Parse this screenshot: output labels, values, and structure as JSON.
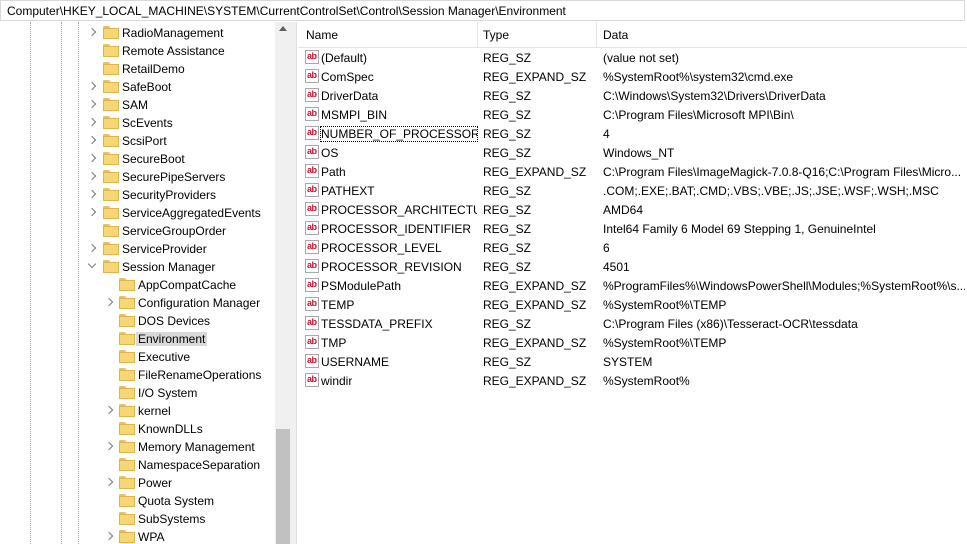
{
  "address_bar": {
    "path": "Computer\\HKEY_LOCAL_MACHINE\\SYSTEM\\CurrentControlSet\\Control\\Session Manager\\Environment"
  },
  "tree": {
    "items": [
      {
        "label": "RadioManagement",
        "level": 1,
        "expandable": true,
        "expanded": false,
        "selected": false
      },
      {
        "label": "Remote Assistance",
        "level": 1,
        "expandable": false,
        "expanded": false,
        "selected": false
      },
      {
        "label": "RetailDemo",
        "level": 1,
        "expandable": false,
        "expanded": false,
        "selected": false
      },
      {
        "label": "SafeBoot",
        "level": 1,
        "expandable": true,
        "expanded": false,
        "selected": false
      },
      {
        "label": "SAM",
        "level": 1,
        "expandable": true,
        "expanded": false,
        "selected": false
      },
      {
        "label": "ScEvents",
        "level": 1,
        "expandable": true,
        "expanded": false,
        "selected": false
      },
      {
        "label": "ScsiPort",
        "level": 1,
        "expandable": true,
        "expanded": false,
        "selected": false
      },
      {
        "label": "SecureBoot",
        "level": 1,
        "expandable": true,
        "expanded": false,
        "selected": false
      },
      {
        "label": "SecurePipeServers",
        "level": 1,
        "expandable": true,
        "expanded": false,
        "selected": false
      },
      {
        "label": "SecurityProviders",
        "level": 1,
        "expandable": true,
        "expanded": false,
        "selected": false
      },
      {
        "label": "ServiceAggregatedEvents",
        "level": 1,
        "expandable": true,
        "expanded": false,
        "selected": false
      },
      {
        "label": "ServiceGroupOrder",
        "level": 1,
        "expandable": false,
        "expanded": false,
        "selected": false
      },
      {
        "label": "ServiceProvider",
        "level": 1,
        "expandable": true,
        "expanded": false,
        "selected": false
      },
      {
        "label": "Session Manager",
        "level": 1,
        "expandable": true,
        "expanded": true,
        "selected": false
      },
      {
        "label": "AppCompatCache",
        "level": 2,
        "expandable": false,
        "expanded": false,
        "selected": false
      },
      {
        "label": "Configuration Manager",
        "level": 2,
        "expandable": true,
        "expanded": false,
        "selected": false
      },
      {
        "label": "DOS Devices",
        "level": 2,
        "expandable": false,
        "expanded": false,
        "selected": false
      },
      {
        "label": "Environment",
        "level": 2,
        "expandable": false,
        "expanded": false,
        "selected": true
      },
      {
        "label": "Executive",
        "level": 2,
        "expandable": false,
        "expanded": false,
        "selected": false
      },
      {
        "label": "FileRenameOperations",
        "level": 2,
        "expandable": false,
        "expanded": false,
        "selected": false
      },
      {
        "label": "I/O System",
        "level": 2,
        "expandable": false,
        "expanded": false,
        "selected": false
      },
      {
        "label": "kernel",
        "level": 2,
        "expandable": true,
        "expanded": false,
        "selected": false
      },
      {
        "label": "KnownDLLs",
        "level": 2,
        "expandable": false,
        "expanded": false,
        "selected": false
      },
      {
        "label": "Memory Management",
        "level": 2,
        "expandable": true,
        "expanded": false,
        "selected": false
      },
      {
        "label": "NamespaceSeparation",
        "level": 2,
        "expandable": false,
        "expanded": false,
        "selected": false
      },
      {
        "label": "Power",
        "level": 2,
        "expandable": true,
        "expanded": false,
        "selected": false
      },
      {
        "label": "Quota System",
        "level": 2,
        "expandable": false,
        "expanded": false,
        "selected": false
      },
      {
        "label": "SubSystems",
        "level": 2,
        "expandable": false,
        "expanded": false,
        "selected": false
      },
      {
        "label": "WPA",
        "level": 2,
        "expandable": true,
        "expanded": false,
        "selected": false
      }
    ]
  },
  "list": {
    "columns": {
      "name": "Name",
      "type": "Type",
      "data": "Data"
    },
    "rows": [
      {
        "name": "(Default)",
        "type": "REG_SZ",
        "data": "(value not set)",
        "icon": "string-value-icon"
      },
      {
        "name": "ComSpec",
        "type": "REG_EXPAND_SZ",
        "data": "%SystemRoot%\\system32\\cmd.exe",
        "icon": "string-value-icon"
      },
      {
        "name": "DriverData",
        "type": "REG_SZ",
        "data": "C:\\Windows\\System32\\Drivers\\DriverData",
        "icon": "string-value-icon"
      },
      {
        "name": "MSMPI_BIN",
        "type": "REG_SZ",
        "data": "C:\\Program Files\\Microsoft MPI\\Bin\\",
        "icon": "string-value-icon"
      },
      {
        "name": "NUMBER_OF_PROCESSORS",
        "type": "REG_SZ",
        "data": "4",
        "icon": "string-value-icon",
        "focused": true
      },
      {
        "name": "OS",
        "type": "REG_SZ",
        "data": "Windows_NT",
        "icon": "string-value-icon"
      },
      {
        "name": "Path",
        "type": "REG_EXPAND_SZ",
        "data": "C:\\Program Files\\ImageMagick-7.0.8-Q16;C:\\Program Files\\Micro...",
        "icon": "string-value-icon"
      },
      {
        "name": "PATHEXT",
        "type": "REG_SZ",
        "data": ".COM;.EXE;.BAT;.CMD;.VBS;.VBE;.JS;.JSE;.WSF;.WSH;.MSC",
        "icon": "string-value-icon"
      },
      {
        "name": "PROCESSOR_ARCHITECTURE",
        "type": "REG_SZ",
        "data": "AMD64",
        "icon": "string-value-icon"
      },
      {
        "name": "PROCESSOR_IDENTIFIER",
        "type": "REG_SZ",
        "data": "Intel64 Family 6 Model 69 Stepping 1, GenuineIntel",
        "icon": "string-value-icon"
      },
      {
        "name": "PROCESSOR_LEVEL",
        "type": "REG_SZ",
        "data": "6",
        "icon": "string-value-icon"
      },
      {
        "name": "PROCESSOR_REVISION",
        "type": "REG_SZ",
        "data": "4501",
        "icon": "string-value-icon"
      },
      {
        "name": "PSModulePath",
        "type": "REG_EXPAND_SZ",
        "data": "%ProgramFiles%\\WindowsPowerShell\\Modules;%SystemRoot%\\s...",
        "icon": "string-value-icon"
      },
      {
        "name": "TEMP",
        "type": "REG_EXPAND_SZ",
        "data": "%SystemRoot%\\TEMP",
        "icon": "string-value-icon"
      },
      {
        "name": "TESSDATA_PREFIX",
        "type": "REG_SZ",
        "data": "C:\\Program Files (x86)\\Tesseract-OCR\\tessdata",
        "icon": "string-value-icon"
      },
      {
        "name": "TMP",
        "type": "REG_EXPAND_SZ",
        "data": "%SystemRoot%\\TEMP",
        "icon": "string-value-icon"
      },
      {
        "name": "USERNAME",
        "type": "REG_SZ",
        "data": "SYSTEM",
        "icon": "string-value-icon"
      },
      {
        "name": "windir",
        "type": "REG_EXPAND_SZ",
        "data": "%SystemRoot%",
        "icon": "string-value-icon"
      }
    ]
  },
  "icons": {
    "value_icon_glyph": "ab",
    "folder": "folder-icon"
  }
}
